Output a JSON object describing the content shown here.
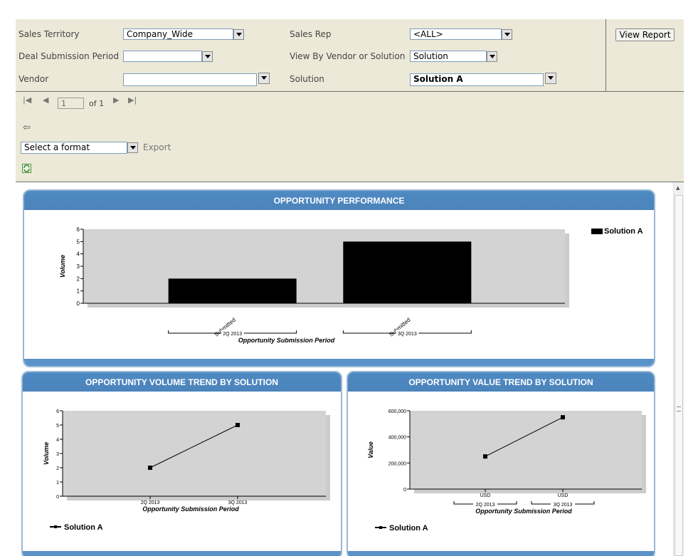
{
  "params": {
    "sales_territory": {
      "label": "Sales Territory",
      "value": "Company_Wide"
    },
    "sales_rep": {
      "label": "Sales Rep",
      "value": "<ALL>"
    },
    "deal_period": {
      "label": "Deal Submission Period",
      "value": ""
    },
    "view_by": {
      "label": "View By Vendor or Solution",
      "value": "Solution"
    },
    "vendor": {
      "label": "Vendor",
      "value": ""
    },
    "solution": {
      "label": "Solution",
      "value": "Solution A"
    },
    "view_report": "View Report"
  },
  "toolbar": {
    "page": "1",
    "of_label": "of 1",
    "format_placeholder": "Select a format",
    "export_label": "Export"
  },
  "charts": {
    "performance": {
      "title": "OPPORTUNITY PERFORMANCE",
      "legend": "Solution A"
    },
    "volume_trend": {
      "title": "OPPORTUNITY VOLUME TREND BY SOLUTION",
      "legend": "Solution A"
    },
    "value_trend": {
      "title": "OPPORTUNITY VALUE TREND BY SOLUTION",
      "legend": "Solution A"
    }
  },
  "colors": {
    "header_blue": "#4f8ac2",
    "plot_bg": "#d3d3d3",
    "params_bg": "#ece9d8"
  },
  "chart_data": [
    {
      "type": "bar",
      "title": "OPPORTUNITY PERFORMANCE",
      "xlabel": "Opportunity Submission Period",
      "ylabel": "Volume",
      "groups": [
        "2Q 2013",
        "3Q 2013"
      ],
      "categories": [
        "Submitted",
        "Submitted"
      ],
      "series": [
        {
          "name": "Solution A",
          "values": [
            2,
            5
          ]
        }
      ],
      "yticks": [
        "0",
        "1",
        "2",
        "3",
        "4",
        "5",
        "6"
      ],
      "ylim": [
        0,
        6
      ],
      "legend": "right"
    },
    {
      "type": "line",
      "title": "OPPORTUNITY VOLUME TREND BY SOLUTION",
      "xlabel": "Opportunity Submission Period",
      "ylabel": "Volume",
      "categories": [
        "2Q 2013",
        "3Q 2013"
      ],
      "series": [
        {
          "name": "Solution A",
          "values": [
            2,
            5
          ]
        }
      ],
      "yticks": [
        "0",
        "1",
        "2",
        "3",
        "4",
        "5",
        "6"
      ],
      "ylim": [
        0,
        6
      ],
      "legend": "bottom-left"
    },
    {
      "type": "line",
      "title": "OPPORTUNITY VALUE TREND BY SOLUTION",
      "xlabel": "Opportunity Submission Period",
      "ylabel": "Value",
      "groups": [
        "2Q 2013",
        "3Q 2013"
      ],
      "categories": [
        "USD",
        "USD"
      ],
      "series": [
        {
          "name": "Solution A",
          "values": [
            250000,
            550000
          ]
        }
      ],
      "yticks": [
        "0",
        "200,000",
        "400,000",
        "600,000"
      ],
      "ylim": [
        0,
        600000
      ],
      "legend": "bottom-left"
    }
  ]
}
